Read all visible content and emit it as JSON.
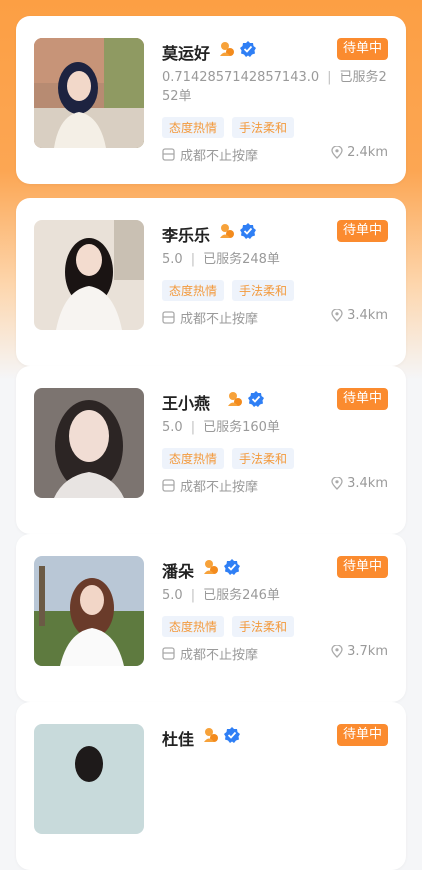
{
  "therapists": [
    {
      "name": "莫运好",
      "status": "待单中",
      "rating": "0.7142857142857143.0",
      "served": "已服务252单",
      "tags": [
        "态度热情",
        "手法柔和"
      ],
      "store": "成都不止按摩",
      "distance": "2.4km"
    },
    {
      "name": "李乐乐",
      "status": "待单中",
      "rating": "5.0",
      "served": "已服务248单",
      "tags": [
        "态度热情",
        "手法柔和"
      ],
      "store": "成都不止按摩",
      "distance": "3.4km"
    },
    {
      "name": "王小燕",
      "status": "待单中",
      "rating": "5.0",
      "served": "已服务160单",
      "tags": [
        "态度热情",
        "手法柔和"
      ],
      "store": "成都不止按摩",
      "distance": "3.4km"
    },
    {
      "name": "潘朵",
      "status": "待单中",
      "rating": "5.0",
      "served": "已服务246单",
      "tags": [
        "态度热情",
        "手法柔和"
      ],
      "store": "成都不止按摩",
      "distance": "3.7km"
    },
    {
      "name": "杜佳",
      "status": "待单中"
    }
  ],
  "colors": {
    "accent": "#fb8b2f",
    "tag_bg": "#eef3fb",
    "tag_text": "#f39a3d",
    "verified": "#2f7ff5"
  }
}
